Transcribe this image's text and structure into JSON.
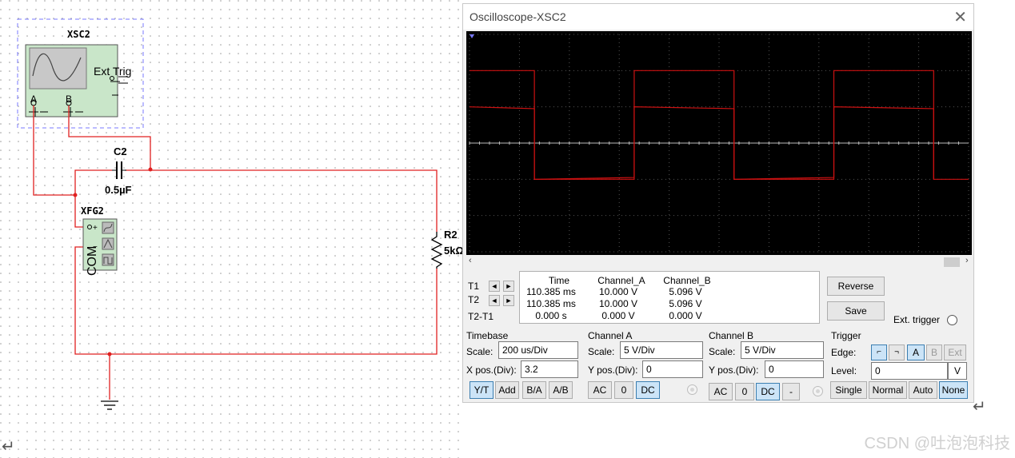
{
  "schematic": {
    "xsc2_label": "XSC2",
    "ext_trig_label": "Ext Trig",
    "pin_a": "A",
    "pin_b": "B",
    "c2_label": "C2",
    "c2_value": "0.5µF",
    "xfg2_label": "XFG2",
    "com_label": "COM",
    "r2_label": "R2",
    "r2_value": "5kΩ"
  },
  "oscilloscope": {
    "title": "Oscilloscope-XSC2",
    "close_icon": "close-icon",
    "readout": {
      "headers": [
        "Time",
        "Channel_A",
        "Channel_B"
      ],
      "rows": [
        {
          "label": "T1",
          "time": "110.385 ms",
          "a": "10.000 V",
          "b": "5.096 V"
        },
        {
          "label": "T2",
          "time": "110.385 ms",
          "a": "10.000 V",
          "b": "5.096 V"
        },
        {
          "label": "T2-T1",
          "time": "0.000 s",
          "a": "0.000 V",
          "b": "0.000 V"
        }
      ]
    },
    "reverse_button": "Reverse",
    "save_button": "Save",
    "ext_trigger_label": "Ext. trigger",
    "timebase": {
      "title": "Timebase",
      "scale_label": "Scale:",
      "scale_value": "200 us/Div",
      "xpos_label": "X pos.(Div):",
      "xpos_value": "3.2",
      "buttons": [
        "Y/T",
        "Add",
        "B/A",
        "A/B"
      ],
      "selected": "Y/T"
    },
    "channel_a": {
      "title": "Channel A",
      "scale_label": "Scale:",
      "scale_value": "5  V/Div",
      "ypos_label": "Y pos.(Div):",
      "ypos_value": "0",
      "buttons": [
        "AC",
        "0",
        "DC"
      ],
      "selected": "DC"
    },
    "channel_b": {
      "title": "Channel B",
      "scale_label": "Scale:",
      "scale_value": "5  V/Div",
      "ypos_label": "Y pos.(Div):",
      "ypos_value": "0",
      "buttons": [
        "AC",
        "0",
        "DC",
        "-"
      ],
      "selected": "DC"
    },
    "trigger": {
      "title": "Trigger",
      "edge_label": "Edge:",
      "edge_buttons": [
        "rising-edge-icon",
        "falling-edge-icon"
      ],
      "source_buttons": [
        "A",
        "B",
        "Ext"
      ],
      "source_selected": "A",
      "level_label": "Level:",
      "level_value": "0",
      "level_unit": "V",
      "mode_buttons": [
        "Single",
        "Normal",
        "Auto",
        "None"
      ],
      "mode_selected": "None"
    },
    "waveform": {
      "channel_a_levels_div": [
        2,
        -1
      ],
      "channel_b_levels_div": [
        1,
        -1
      ],
      "trace_color": "#cc1111",
      "screen_color": "#000000",
      "grid_color": "#555555"
    }
  },
  "watermark": "CSDN @吐泡泡科技"
}
